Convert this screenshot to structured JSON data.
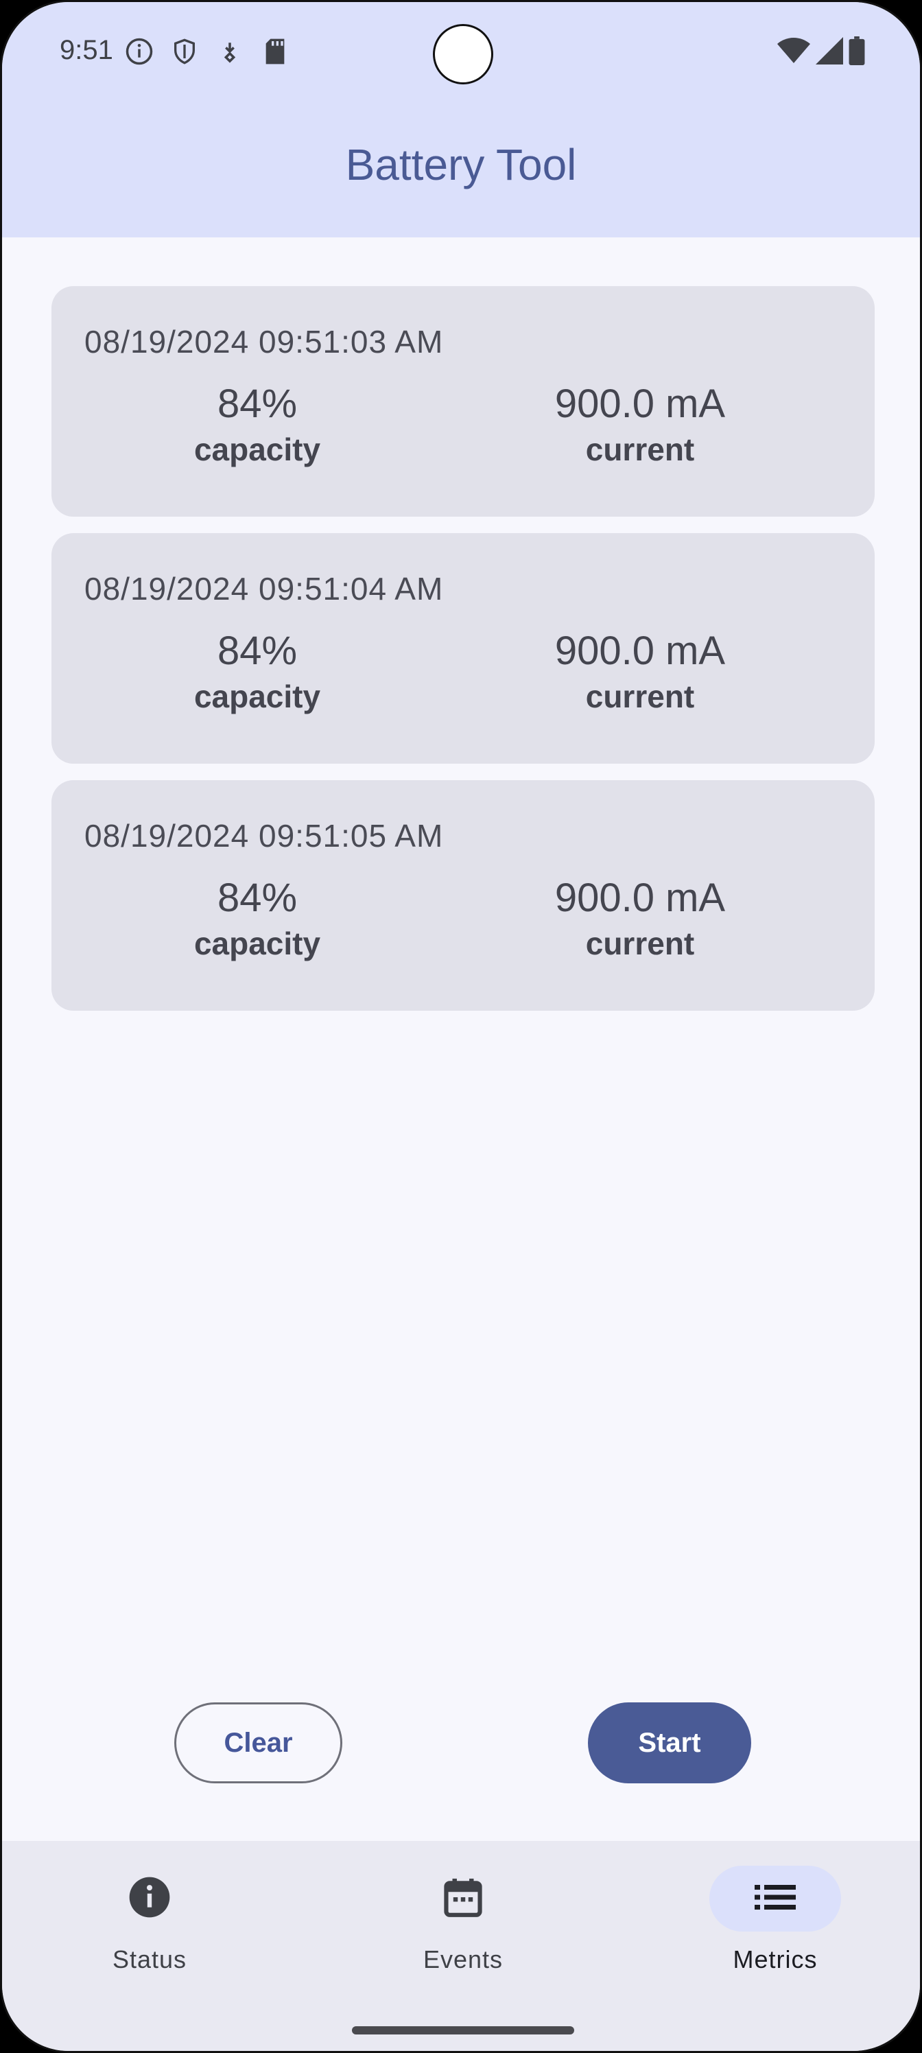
{
  "status_bar": {
    "time": "9:51"
  },
  "app_bar": {
    "title": "Battery Tool"
  },
  "metrics": [
    {
      "timestamp": "08/19/2024 09:51:03 AM",
      "capacity_value": "84%",
      "capacity_label": "capacity",
      "current_value": "900.0 mA",
      "current_label": "current"
    },
    {
      "timestamp": "08/19/2024 09:51:04 AM",
      "capacity_value": "84%",
      "capacity_label": "capacity",
      "current_value": "900.0 mA",
      "current_label": "current"
    },
    {
      "timestamp": "08/19/2024 09:51:05 AM",
      "capacity_value": "84%",
      "capacity_label": "capacity",
      "current_value": "900.0 mA",
      "current_label": "current"
    }
  ],
  "actions": {
    "clear_label": "Clear",
    "start_label": "Start"
  },
  "bottom_nav": {
    "items": [
      {
        "label": "Status",
        "icon": "info-icon",
        "active": false
      },
      {
        "label": "Events",
        "icon": "calendar-icon",
        "active": false
      },
      {
        "label": "Metrics",
        "icon": "list-icon",
        "active": true
      }
    ]
  },
  "colors": {
    "primary": "#4a5b96",
    "app_bar_bg": "#dbe0fb",
    "card_bg": "#e1e1ea",
    "page_bg": "#f7f7fd"
  }
}
